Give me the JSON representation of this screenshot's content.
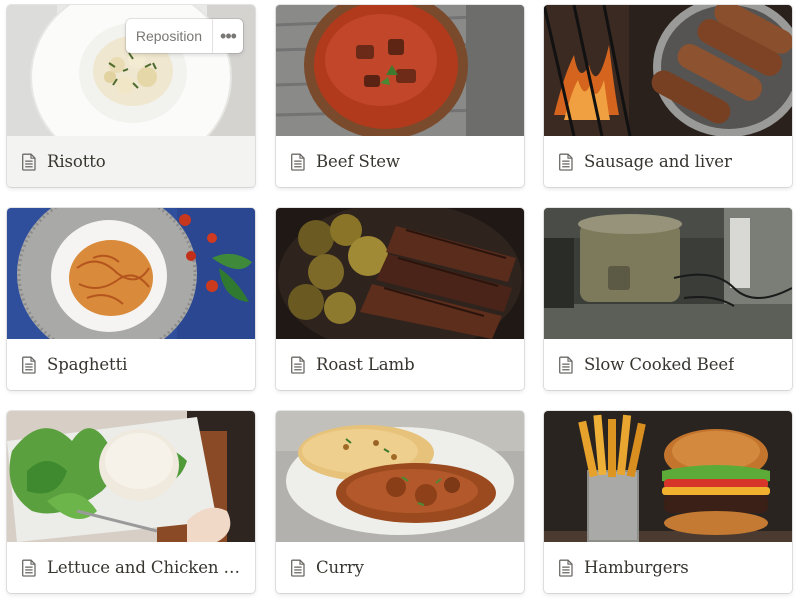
{
  "gallery": {
    "cards": [
      {
        "title": "Risotto",
        "image": "risotto-photo",
        "hover_actions": {
          "reposition_label": "Reposition",
          "more_icon": "more-horizontal-icon",
          "more_glyph": "•••"
        }
      },
      {
        "title": "Beef Stew",
        "image": "beef-stew-photo"
      },
      {
        "title": "Sausage and liver",
        "image": "sausage-pan-photo"
      },
      {
        "title": "Spaghetti",
        "image": "spaghetti-photo"
      },
      {
        "title": "Roast Lamb",
        "image": "roast-lamb-photo"
      },
      {
        "title": "Slow Cooked Beef",
        "image": "slow-cooker-photo"
      },
      {
        "title": "Lettuce and Chicken wrap",
        "image": "lettuce-salad-photo"
      },
      {
        "title": "Curry",
        "image": "curry-naan-photo"
      },
      {
        "title": "Hamburgers",
        "image": "burger-fries-photo"
      }
    ],
    "page_icon": "page-document-icon",
    "colors": {
      "title_text": "#37352f",
      "secondary_text": "#787774",
      "hover_card_bg": "#f3f3f1"
    }
  }
}
